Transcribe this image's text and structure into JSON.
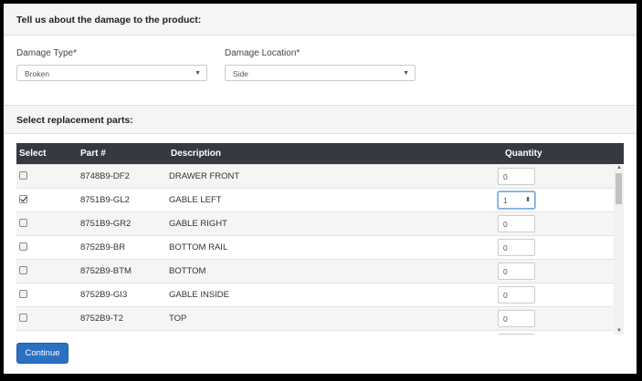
{
  "damage_section": {
    "title": "Tell us about the damage to the product:"
  },
  "damage_type": {
    "label": "Damage Type*",
    "value": "Broken"
  },
  "damage_location": {
    "label": "Damage Location*",
    "value": "Side"
  },
  "parts_section": {
    "title": "Select replacement parts:"
  },
  "table": {
    "headers": {
      "select": "Select",
      "part": "Part #",
      "description": "Description",
      "quantity": "Quantity"
    },
    "rows": [
      {
        "checked": false,
        "part": "8748B9-DF2",
        "description": "DRAWER FRONT",
        "quantity": "0"
      },
      {
        "checked": true,
        "part": "8751B9-GL2",
        "description": "GABLE LEFT",
        "quantity": "1"
      },
      {
        "checked": false,
        "part": "8751B9-GR2",
        "description": "GABLE RIGHT",
        "quantity": "0"
      },
      {
        "checked": false,
        "part": "8752B9-BR",
        "description": "BOTTOM RAIL",
        "quantity": "0"
      },
      {
        "checked": false,
        "part": "8752B9-BTM",
        "description": "BOTTOM",
        "quantity": "0"
      },
      {
        "checked": false,
        "part": "8752B9-GI3",
        "description": "GABLE INSIDE",
        "quantity": "0"
      },
      {
        "checked": false,
        "part": "8752B9-T2",
        "description": "TOP",
        "quantity": "0"
      }
    ]
  },
  "continue_button": {
    "label": "Continue"
  },
  "colors": {
    "header_bg": "#343a40",
    "button_bg": "#2a71c3"
  }
}
